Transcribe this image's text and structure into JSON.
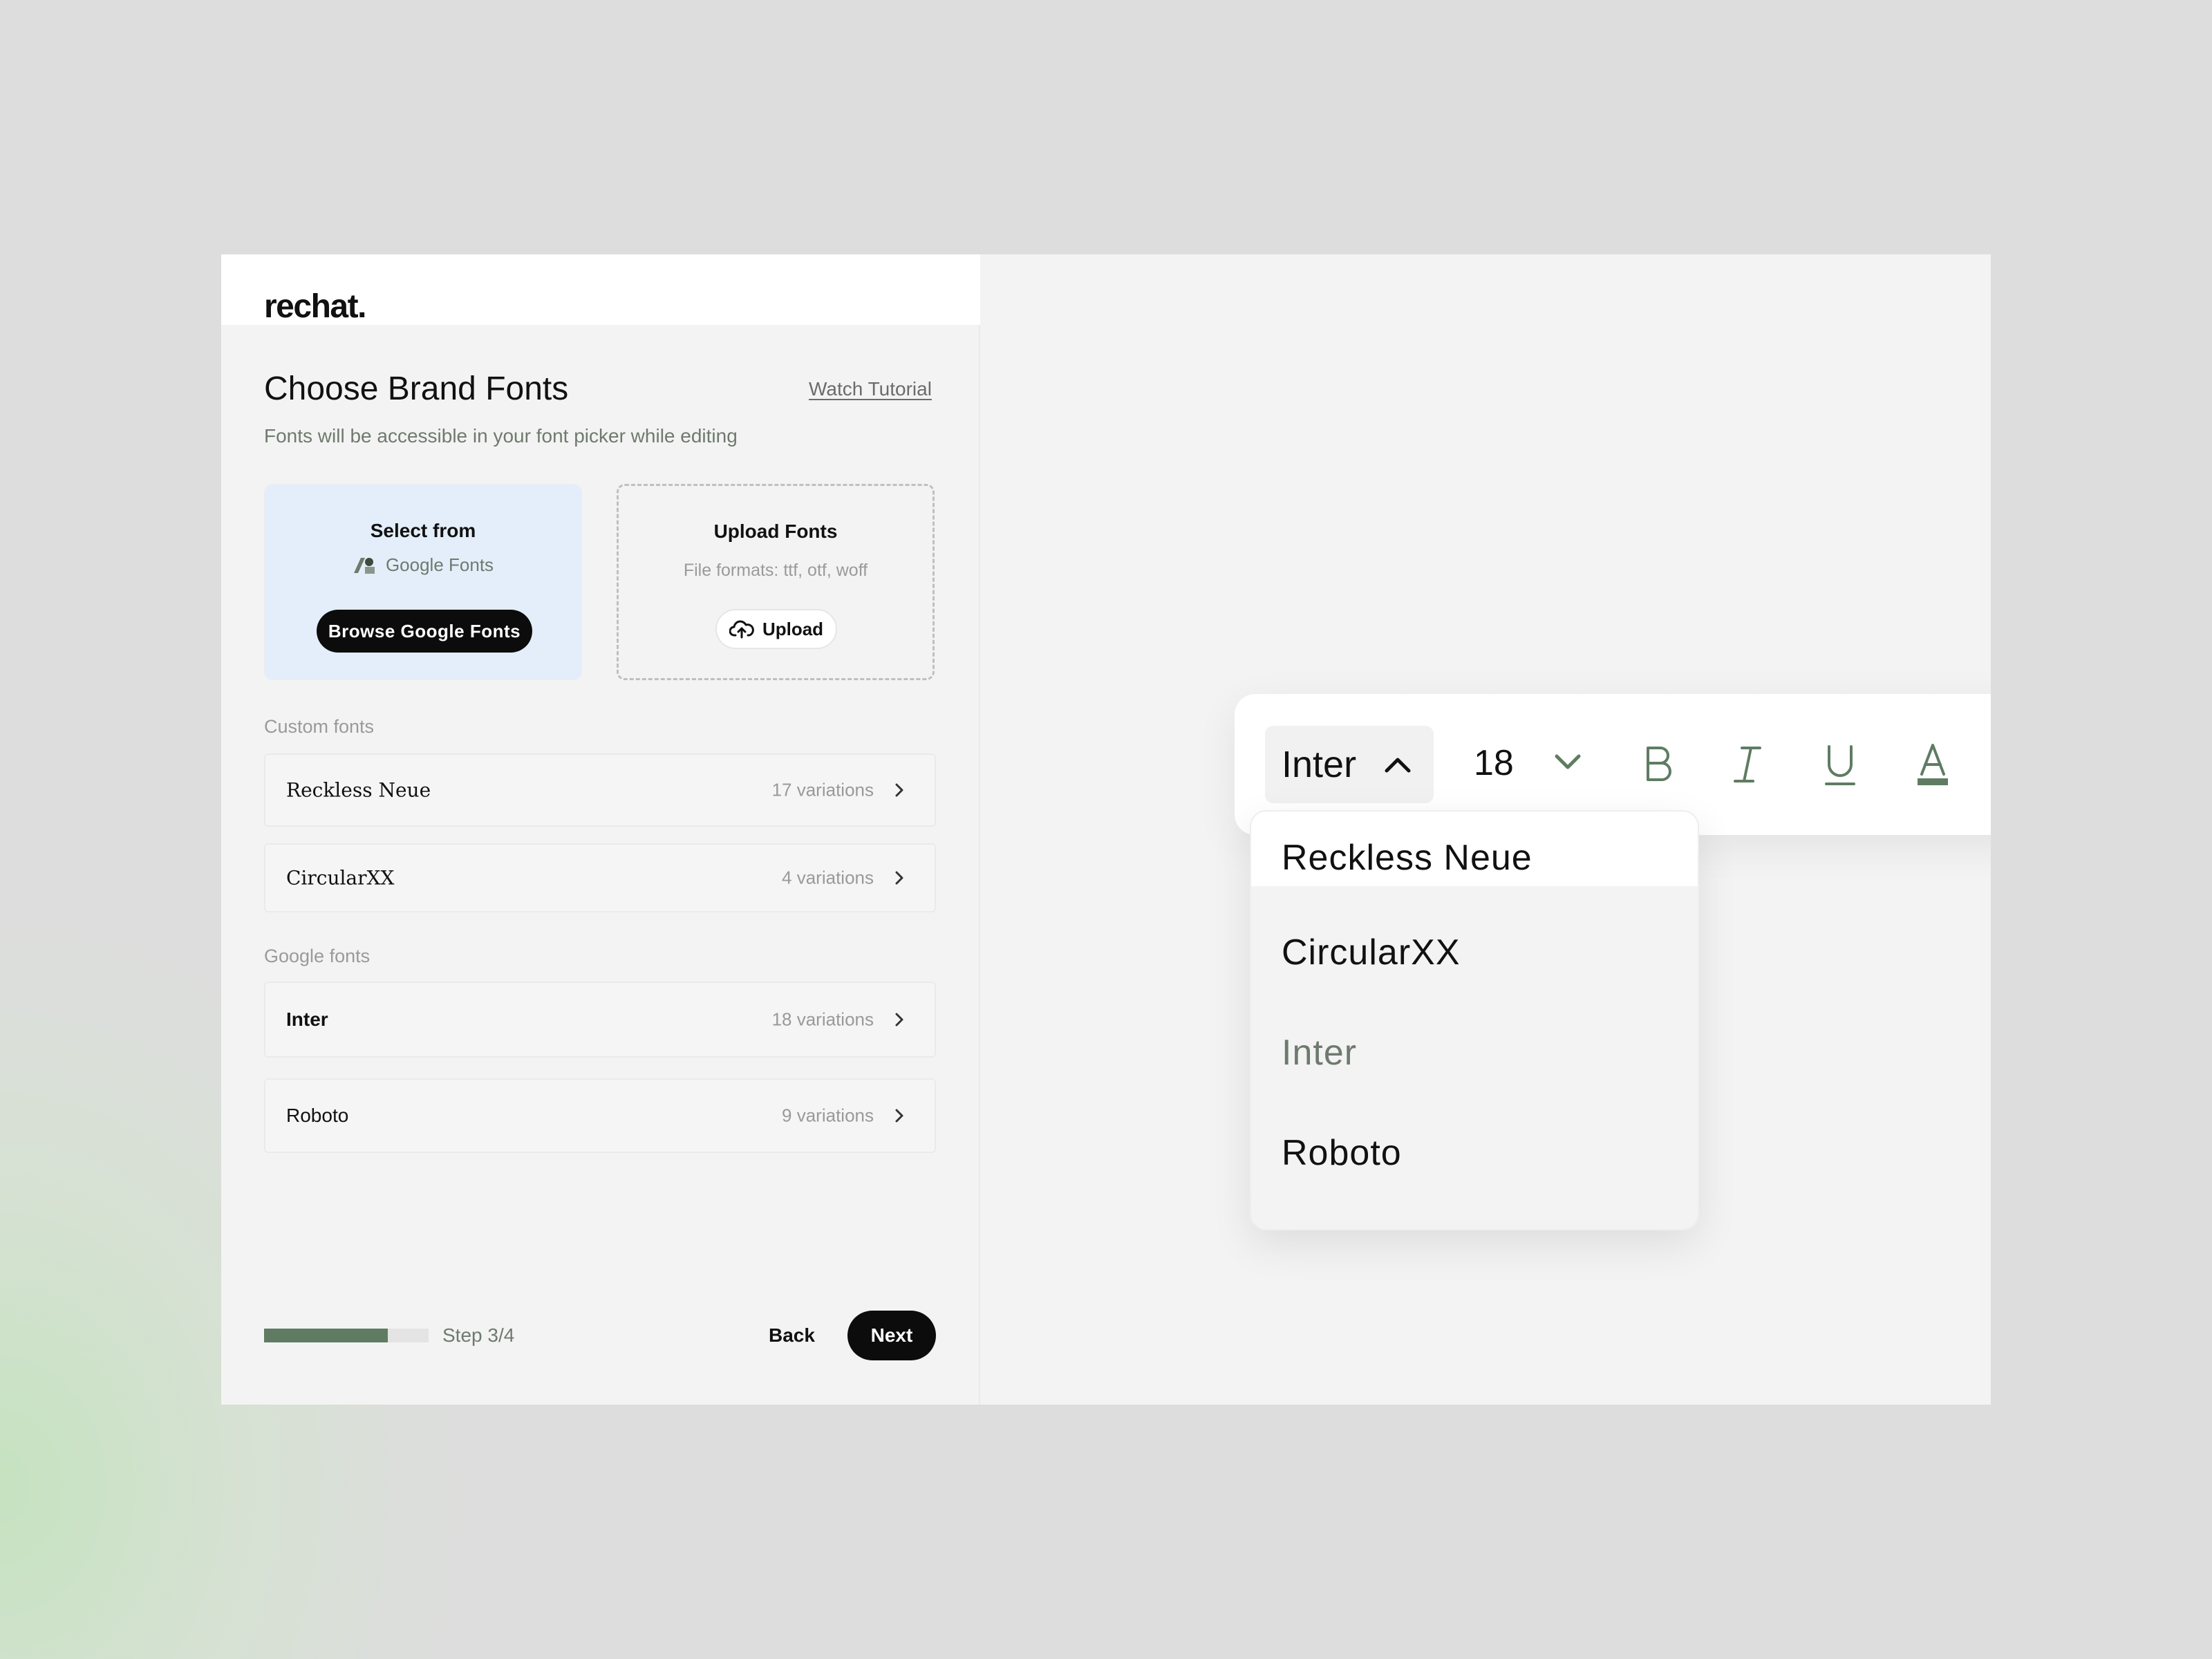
{
  "brand": {
    "logo": "rechat."
  },
  "header": {
    "title": "Choose Brand Fonts",
    "tutorial_link": "Watch Tutorial",
    "subtitle": "Fonts will be accessible in your font picker while editing"
  },
  "google_card": {
    "title": "Select from",
    "provider": "Google Fonts",
    "button": "Browse Google Fonts"
  },
  "upload_card": {
    "title": "Upload Fonts",
    "hint": "File formats: ttf, otf, woff",
    "button": "Upload"
  },
  "custom_fonts": {
    "label": "Custom fonts",
    "items": [
      {
        "name": "Reckless Neue",
        "variations": "17 variations"
      },
      {
        "name": "CircularXX",
        "variations": "4 variations"
      }
    ]
  },
  "google_fonts": {
    "label": "Google fonts",
    "items": [
      {
        "name": "Inter",
        "variations": "18 variations"
      },
      {
        "name": "Roboto",
        "variations": "9 variations"
      }
    ]
  },
  "footer": {
    "progress": 0.75,
    "step_label": "Step 3/4",
    "back": "Back",
    "next": "Next"
  },
  "toolbar": {
    "font": "Inter",
    "size": "18",
    "icons": [
      "bold-icon",
      "italic-icon",
      "underline-icon",
      "text-color-icon"
    ],
    "accent_color": "#5f7c62"
  },
  "font_dropdown": {
    "options": [
      "Reckless Neue",
      "CircularXX",
      "Inter",
      "Roboto"
    ],
    "highlighted": "Reckless Neue",
    "selected": "Inter"
  }
}
